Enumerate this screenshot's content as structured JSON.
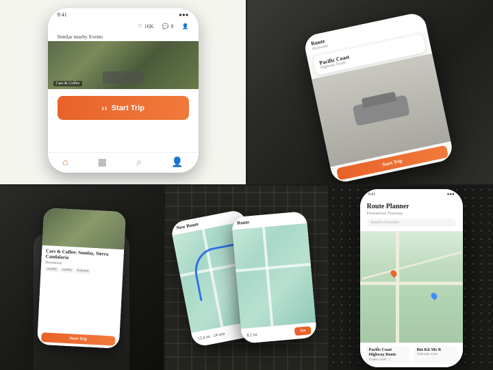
{
  "panels": {
    "top_left": {
      "social": {
        "likes": "16K",
        "comments": "8",
        "profile_icon": "♡",
        "comment_icon": "💬",
        "person_icon": "👤"
      },
      "nearby_label": "Similar nearby Events",
      "start_trip_btn": "Start Trip",
      "nav": {
        "home": "⌂",
        "map": "▦",
        "search": "⌕",
        "user": "👤"
      }
    },
    "top_right": {
      "route_title": "Route",
      "route_subtitle": "Overview",
      "location": {
        "name": "Pacific Coast",
        "sub": "Highway South"
      },
      "start_btn": "Start Trip"
    },
    "bottom_left": {
      "event_title": "Cars & Coffee: Sunday, Sierra Candalaria",
      "event_sub": "Downtown",
      "tags": [
        "weekly",
        "nearby",
        "featured"
      ],
      "btn_label": "Start Trip"
    },
    "bottom_middle": {
      "header": "New Route",
      "go_btn": "Go",
      "route_info": "12.4 mi · 24 min"
    },
    "bottom_right": {
      "time": "9:41",
      "title": "Route Planner",
      "subtitle": "Downtown Freeway",
      "search_placeholder": "Search a location",
      "destinations": [
        {
          "name": "Pacific Coast Highway Route",
          "sub": "Fastest route · 1"
        },
        {
          "name": "But Kit 58x R",
          "sub": "Alternate route"
        }
      ]
    }
  },
  "colors": {
    "accent": "#e8622a",
    "accent_light": "#f07a3a",
    "blue": "#3070e8",
    "dark_bg": "#1a1a1a",
    "light_bg": "#f5f5f0"
  }
}
